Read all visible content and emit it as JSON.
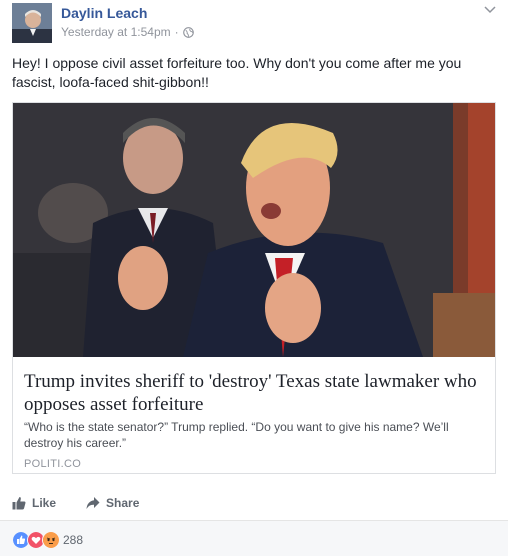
{
  "post": {
    "author": "Daylin Leach",
    "timestamp": "Yesterday at 1:54pm",
    "separator": "·",
    "privacy_icon": "globe-icon",
    "message": "Hey! I oppose civil asset forfeiture too. Why don't you come after me you fascist, loofa-faced shit-gibbon!!"
  },
  "link_card": {
    "title": "Trump invites sheriff to 'destroy' Texas state lawmaker who opposes asset forfeiture",
    "description": "“Who is the state senator?” Trump replied. “Do you want to give his name? We’ll destroy his career.”",
    "source": "POLITI.CO"
  },
  "actions": {
    "like_label": "Like",
    "share_label": "Share"
  },
  "reactions": {
    "icons": [
      "like-reaction-icon",
      "love-reaction-icon",
      "angry-reaction-icon"
    ],
    "count": "288"
  },
  "colors": {
    "link_blue": "#365899",
    "secondary_text": "#90949c",
    "like_blue": "#5890ff",
    "love_red": "#f25268",
    "angry_orange": "#f7714b"
  }
}
